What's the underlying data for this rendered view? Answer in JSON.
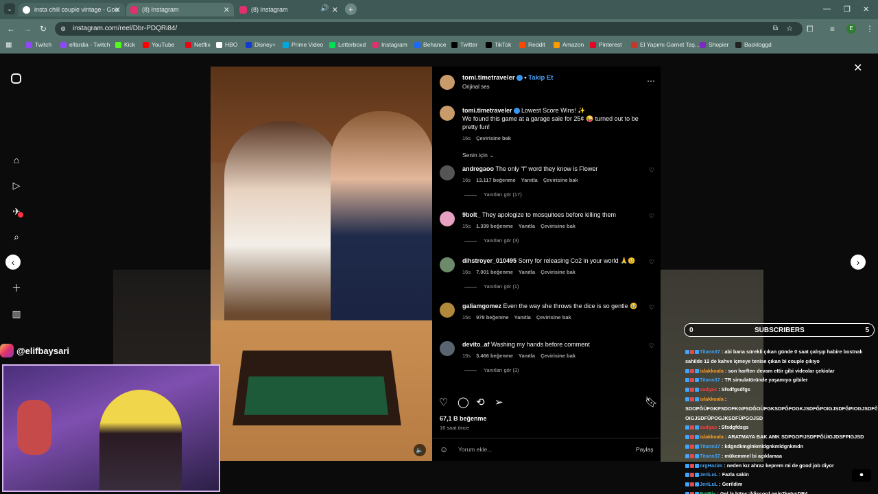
{
  "browser": {
    "tabs": [
      {
        "title": "insta chill couple vintage - Goo",
        "favicon_color": "#ffffff"
      },
      {
        "title": "(8) Instagram",
        "favicon_color": "#e1306c"
      },
      {
        "title": "(8) Instagram",
        "favicon_color": "#e1306c"
      }
    ],
    "url": "instagram.com/reel/Dbr-PDQRi84/",
    "profile_initial": "E",
    "bookmarks": [
      {
        "label": "Twitch",
        "color": "#9146ff"
      },
      {
        "label": "elfardia - Twitch",
        "color": "#9146ff"
      },
      {
        "label": "Kick",
        "color": "#53fc18"
      },
      {
        "label": "YouTube",
        "color": "#ff0000"
      },
      {
        "label": "Netflix",
        "color": "#e50914"
      },
      {
        "label": "HBO",
        "color": "#ffffff"
      },
      {
        "label": "Disney+",
        "color": "#113ccf"
      },
      {
        "label": "Prime Video",
        "color": "#00a8e1"
      },
      {
        "label": "Letterboxd",
        "color": "#00e054"
      },
      {
        "label": "Instagram",
        "color": "#e1306c"
      },
      {
        "label": "Behance",
        "color": "#1769ff"
      },
      {
        "label": "Twitter",
        "color": "#000000"
      },
      {
        "label": "TikTok",
        "color": "#000000"
      },
      {
        "label": "Reddit",
        "color": "#ff4500"
      },
      {
        "label": "Amazon",
        "color": "#ff9900"
      },
      {
        "label": "Pinterest",
        "color": "#e60023"
      },
      {
        "label": "El Yapımı Garnet Taş...",
        "color": "#c0392b"
      },
      {
        "label": "Shopier",
        "color": "#7b2cbf"
      },
      {
        "label": "Backloggd",
        "color": "#222222"
      }
    ]
  },
  "post": {
    "author": "tomi.timetraveler",
    "follow_label": "Takip Et",
    "audio": "Orijinal ses",
    "caption_title": "Lowest Score Wins! ✨",
    "caption_body": "We found this game at a garage sale for 25¢ 😜 turned out to be pretty fun!",
    "caption_time": "16s",
    "caption_translate": "Çevirisine bak",
    "sort_label": "Senin için",
    "comments": [
      {
        "user": "andregaoo",
        "text": "The only “f” word they know is Flower",
        "time": "16s",
        "likes": "13.117 beğenme",
        "reply": "Yanıtla",
        "translate": "Çevirisine bak",
        "replies": "Yanıtları gör (17)"
      },
      {
        "user": "9bolt_",
        "text": "They apologize to mosquitoes before killing them",
        "time": "15s",
        "likes": "1.339 beğenme",
        "reply": "Yanıtla",
        "translate": "Çevirisine bak",
        "replies": "Yanıtları gör (3)"
      },
      {
        "user": "dihstroyer_010495",
        "text": "Sorry for releasing Co2 in your world 🙏😊",
        "time": "16s",
        "likes": "7.001 beğenme",
        "reply": "Yanıtla",
        "translate": "Çevirisine bak",
        "replies": "Yanıtları gör (1)"
      },
      {
        "user": "galiamgomez",
        "text": "Even the way she throws the dice is so gentle 🥹",
        "time": "15s",
        "likes": "978 beğenme",
        "reply": "Yanıtla",
        "translate": "Çevirisine bak",
        "replies": ""
      },
      {
        "user": "devito_af",
        "text": "Washing my hands before comment",
        "time": "15s",
        "likes": "3.466 beğenme",
        "reply": "Yanıtla",
        "translate": "Çevirisine bak",
        "replies": "Yanıtları gör (3)"
      }
    ],
    "likes": "67,1 B beğenme",
    "ago": "16 saat önce",
    "comment_placeholder": "Yorum ekle...",
    "share_label": "Paylaş"
  },
  "stream": {
    "handle": "@elifbaysari",
    "subs_left": "0",
    "subs_title": "SUBSCRIBERS",
    "subs_right": "5",
    "chat": [
      {
        "user": "Titann37",
        "ucolor": "#3ea6ff",
        "msg": ": abi bana sürekli çıkan günde 0 saat çalışıp habire bostnalı"
      },
      {
        "user": "",
        "ucolor": "#ffffff",
        "msg": "sahilde 12 de kahve içmeye tenise çıkan bi couple çıkıyo"
      },
      {
        "user": "islakkoala",
        "ucolor": "#ff9f2a",
        "msg": ": son harften devam ettir gibi videolar çekiolar"
      },
      {
        "user": "Titann37",
        "ucolor": "#3ea6ff",
        "msg": ": TR simulatöründe yaşamıyo gibiler"
      },
      {
        "user": "sadgas",
        "ucolor": "#ff3a3a",
        "msg": ": Sfsdfgsdfgs"
      },
      {
        "user": "islakkoala",
        "ucolor": "#ff9f2a",
        "msg": ":"
      },
      {
        "user": "",
        "ucolor": "#ffffff",
        "msg": "SDOPĞÜFGKPSDOFKGPSDĞOÜFGKSDPĞFOGKJSDFĞPOIGJSDFĞPIOGJSDFĞP"
      },
      {
        "user": "",
        "ucolor": "#ffffff",
        "msg": "OIGJSDFÜPOGJKSDFÜPGOJSD"
      },
      {
        "user": "sadgas",
        "ucolor": "#ff3a3a",
        "msg": ": Sfsdgfdsgs"
      },
      {
        "user": "islakkoala",
        "ucolor": "#ff9f2a",
        "msg": ": ARATMAYA BAK AMK SDPGOFIJSDFPĞÜIGJDSFPIGJSD"
      },
      {
        "user": "Titann37",
        "ucolor": "#3ea6ff",
        "msg": ": kdgndkmglnkmldgnkmldgnkmdn"
      },
      {
        "user": "Titann37",
        "ucolor": "#3ea6ff",
        "msg": ": mükemmel bi açıklamaa"
      },
      {
        "user": "orgHazim",
        "ucolor": "#3ea6ff",
        "msg": ": neden kız ahraz keprem mi de good job diyor"
      },
      {
        "user": "JeriLuL",
        "ucolor": "#3ea6ff",
        "msg": ": Fazla sakin"
      },
      {
        "user": "JeriLuL",
        "ucolor": "#3ea6ff",
        "msg": ": Gerildim"
      },
      {
        "user": "BotRix",
        "ucolor": "#35d07f",
        "msg": ": Gel la https://discord.gg/g7ketvsDR4"
      }
    ]
  }
}
